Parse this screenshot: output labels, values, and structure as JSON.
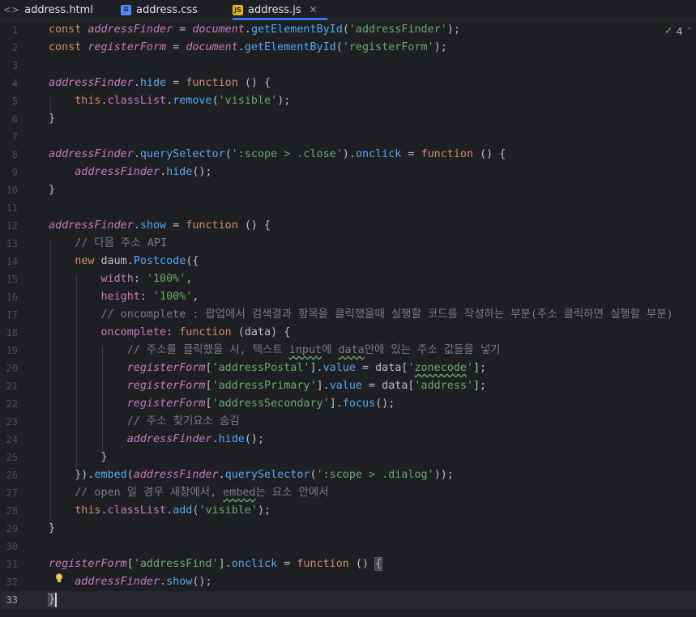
{
  "tabs": [
    {
      "label": "address.html",
      "icon": "html-file-icon",
      "active": false
    },
    {
      "label": "address.css",
      "icon": "css-file-icon",
      "active": false
    },
    {
      "label": "address.js",
      "icon": "js-file-icon",
      "active": true
    }
  ],
  "inspection": {
    "count": "4",
    "icon": "check-warning-icon"
  },
  "lines": [
    {
      "n": "1",
      "segs": [
        [
          "kw",
          "const "
        ],
        [
          "var",
          "addressFinder"
        ],
        [
          "plain",
          " = "
        ],
        [
          "var",
          "document"
        ],
        [
          "plain",
          "."
        ],
        [
          "fn",
          "getElementById"
        ],
        [
          "plain",
          "("
        ],
        [
          "str",
          "'addressFinder'"
        ],
        [
          "plain",
          ");"
        ]
      ]
    },
    {
      "n": "2",
      "segs": [
        [
          "kw",
          "const "
        ],
        [
          "var",
          "registerForm"
        ],
        [
          "plain",
          " = "
        ],
        [
          "var",
          "document"
        ],
        [
          "plain",
          "."
        ],
        [
          "fn",
          "getElementById"
        ],
        [
          "plain",
          "("
        ],
        [
          "str",
          "'registerForm'"
        ],
        [
          "plain",
          ");"
        ]
      ]
    },
    {
      "n": "3",
      "segs": []
    },
    {
      "n": "4",
      "segs": [
        [
          "var",
          "addressFinder"
        ],
        [
          "plain",
          "."
        ],
        [
          "fn",
          "hide"
        ],
        [
          "plain",
          " = "
        ],
        [
          "kw",
          "function"
        ],
        [
          "plain",
          " () {"
        ]
      ]
    },
    {
      "n": "5",
      "segs": [
        [
          "plain",
          "    "
        ],
        [
          "kw",
          "this"
        ],
        [
          "plain",
          "."
        ],
        [
          "prop",
          "classList"
        ],
        [
          "plain",
          "."
        ],
        [
          "fn",
          "remove"
        ],
        [
          "plain",
          "("
        ],
        [
          "str",
          "'visible'"
        ],
        [
          "plain",
          ");"
        ]
      ]
    },
    {
      "n": "6",
      "segs": [
        [
          "plain",
          "}"
        ]
      ]
    },
    {
      "n": "7",
      "segs": []
    },
    {
      "n": "8",
      "segs": [
        [
          "var",
          "addressFinder"
        ],
        [
          "plain",
          "."
        ],
        [
          "fn",
          "querySelector"
        ],
        [
          "plain",
          "("
        ],
        [
          "str",
          "':scope > .close'"
        ],
        [
          "plain",
          ")."
        ],
        [
          "fn",
          "onclick"
        ],
        [
          "plain",
          " = "
        ],
        [
          "kw",
          "function"
        ],
        [
          "plain",
          " () {"
        ]
      ]
    },
    {
      "n": "9",
      "segs": [
        [
          "plain",
          "    "
        ],
        [
          "var",
          "addressFinder"
        ],
        [
          "plain",
          "."
        ],
        [
          "fn",
          "hide"
        ],
        [
          "plain",
          "();"
        ]
      ]
    },
    {
      "n": "10",
      "segs": [
        [
          "plain",
          "}"
        ]
      ]
    },
    {
      "n": "11",
      "segs": []
    },
    {
      "n": "12",
      "segs": [
        [
          "var",
          "addressFinder"
        ],
        [
          "plain",
          "."
        ],
        [
          "fn",
          "show"
        ],
        [
          "plain",
          " = "
        ],
        [
          "kw",
          "function"
        ],
        [
          "plain",
          " () {"
        ]
      ]
    },
    {
      "n": "13",
      "segs": [
        [
          "plain",
          "    "
        ],
        [
          "cmt",
          "// 다음 주소 API"
        ]
      ]
    },
    {
      "n": "14",
      "segs": [
        [
          "plain",
          "    "
        ],
        [
          "kw",
          "new "
        ],
        [
          "plain",
          "daum."
        ],
        [
          "fn",
          "Postcode"
        ],
        [
          "plain",
          "({"
        ]
      ]
    },
    {
      "n": "15",
      "segs": [
        [
          "plain",
          "        "
        ],
        [
          "prop",
          "width"
        ],
        [
          "plain",
          ": "
        ],
        [
          "str",
          "'100%'"
        ],
        [
          "plain",
          ","
        ]
      ]
    },
    {
      "n": "16",
      "segs": [
        [
          "plain",
          "        "
        ],
        [
          "prop",
          "height"
        ],
        [
          "plain",
          ": "
        ],
        [
          "str",
          "'100%'"
        ],
        [
          "plain",
          ","
        ]
      ]
    },
    {
      "n": "17",
      "segs": [
        [
          "plain",
          "        "
        ],
        [
          "cmt",
          "// oncomplete : 팝업에서 검색결과 항목을 클릭했을때 실행할 코드를 작성하는 부분(주소 클릭하면 실행할 부분)"
        ]
      ]
    },
    {
      "n": "18",
      "segs": [
        [
          "plain",
          "        "
        ],
        [
          "prop",
          "oncomplete"
        ],
        [
          "plain",
          ": "
        ],
        [
          "kw",
          "function"
        ],
        [
          "plain",
          " (data) {"
        ]
      ]
    },
    {
      "n": "19",
      "segs": [
        [
          "plain",
          "            "
        ],
        [
          "cmt",
          "// 주소를 클릭했을 시, 텍스트 "
        ],
        [
          "cmt typo",
          "input"
        ],
        [
          "cmt",
          "에 "
        ],
        [
          "cmt typo",
          "data"
        ],
        [
          "cmt",
          "안에 있는 주소 값들을 넣기"
        ]
      ]
    },
    {
      "n": "20",
      "segs": [
        [
          "plain",
          "            "
        ],
        [
          "var",
          "registerForm"
        ],
        [
          "plain",
          "["
        ],
        [
          "str",
          "'addressPostal'"
        ],
        [
          "plain",
          "]."
        ],
        [
          "fn",
          "value"
        ],
        [
          "plain",
          " = data["
        ],
        [
          "str",
          "'"
        ],
        [
          "str typo",
          "zonecode"
        ],
        [
          "str",
          "'"
        ],
        [
          "plain",
          "];"
        ]
      ]
    },
    {
      "n": "21",
      "segs": [
        [
          "plain",
          "            "
        ],
        [
          "var",
          "registerForm"
        ],
        [
          "plain",
          "["
        ],
        [
          "str",
          "'addressPrimary'"
        ],
        [
          "plain",
          "]."
        ],
        [
          "fn",
          "value"
        ],
        [
          "plain",
          " = data["
        ],
        [
          "str",
          "'address'"
        ],
        [
          "plain",
          "];"
        ]
      ]
    },
    {
      "n": "22",
      "segs": [
        [
          "plain",
          "            "
        ],
        [
          "var",
          "registerForm"
        ],
        [
          "plain",
          "["
        ],
        [
          "str",
          "'addressSecondary'"
        ],
        [
          "plain",
          "]."
        ],
        [
          "fn",
          "focus"
        ],
        [
          "plain",
          "();"
        ]
      ]
    },
    {
      "n": "23",
      "segs": [
        [
          "plain",
          "            "
        ],
        [
          "cmt",
          "// 주소 찾기요소 숨김"
        ]
      ]
    },
    {
      "n": "24",
      "segs": [
        [
          "plain",
          "            "
        ],
        [
          "var",
          "addressFinder"
        ],
        [
          "plain",
          "."
        ],
        [
          "fn",
          "hide"
        ],
        [
          "plain",
          "();"
        ]
      ]
    },
    {
      "n": "25",
      "segs": [
        [
          "plain",
          "        }"
        ]
      ]
    },
    {
      "n": "26",
      "segs": [
        [
          "plain",
          "    })."
        ],
        [
          "fn",
          "embed"
        ],
        [
          "plain",
          "("
        ],
        [
          "var",
          "addressFinder"
        ],
        [
          "plain",
          "."
        ],
        [
          "fn",
          "querySelector"
        ],
        [
          "plain",
          "("
        ],
        [
          "str",
          "':scope > .dialog'"
        ],
        [
          "plain",
          "));"
        ]
      ]
    },
    {
      "n": "27",
      "segs": [
        [
          "plain",
          "    "
        ],
        [
          "cmt",
          "// open 일 경우 새창에서, "
        ],
        [
          "cmt typo",
          "embed"
        ],
        [
          "cmt",
          "는 요소 안에서"
        ]
      ]
    },
    {
      "n": "28",
      "segs": [
        [
          "plain",
          "    "
        ],
        [
          "kw",
          "this"
        ],
        [
          "plain",
          "."
        ],
        [
          "prop",
          "classList"
        ],
        [
          "plain",
          "."
        ],
        [
          "fn",
          "add"
        ],
        [
          "plain",
          "("
        ],
        [
          "str",
          "'visible'"
        ],
        [
          "plain",
          ");"
        ]
      ]
    },
    {
      "n": "29",
      "segs": [
        [
          "plain",
          "}"
        ]
      ]
    },
    {
      "n": "30",
      "segs": []
    },
    {
      "n": "31",
      "segs": [
        [
          "var",
          "registerForm"
        ],
        [
          "plain",
          "["
        ],
        [
          "str",
          "'addressFind'"
        ],
        [
          "plain",
          "]."
        ],
        [
          "fn",
          "onclick"
        ],
        [
          "plain",
          " = "
        ],
        [
          "kw",
          "function"
        ],
        [
          "plain",
          " () "
        ],
        [
          "plain bracket-hl",
          "{"
        ]
      ]
    },
    {
      "n": "32",
      "segs": [
        [
          "plain",
          "    "
        ],
        [
          "var",
          "addressFinder"
        ],
        [
          "plain",
          "."
        ],
        [
          "fn",
          "show"
        ],
        [
          "plain",
          "();"
        ]
      ]
    },
    {
      "n": "33",
      "segs": [
        [
          "plain bracket-hl",
          "}"
        ]
      ]
    }
  ]
}
